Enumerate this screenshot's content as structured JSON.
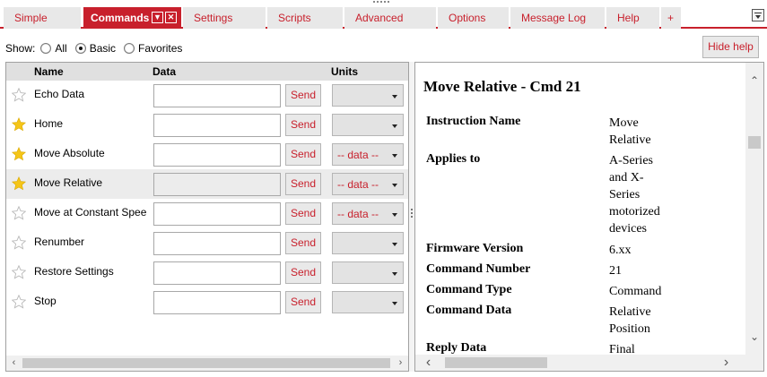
{
  "tabs": [
    {
      "label": "Simple",
      "active": false
    },
    {
      "label": "Commands",
      "active": true
    },
    {
      "label": "Settings",
      "active": false
    },
    {
      "label": "Scripts",
      "active": false
    },
    {
      "label": "Advanced",
      "active": false
    },
    {
      "label": "Options",
      "active": false
    },
    {
      "label": "Message Log",
      "active": false
    },
    {
      "label": "Help",
      "active": false
    },
    {
      "label": "+",
      "active": false
    }
  ],
  "show": {
    "label": "Show:",
    "options": [
      {
        "label": "All",
        "selected": false
      },
      {
        "label": "Basic",
        "selected": true
      },
      {
        "label": "Favorites",
        "selected": false
      }
    ]
  },
  "hide_help_label": "Hide help",
  "table": {
    "columns": {
      "name": "Name",
      "data": "Data",
      "units": "Units"
    },
    "rows": [
      {
        "name": "Echo Data",
        "favorite": false,
        "send": "Send",
        "units": "",
        "selected": false
      },
      {
        "name": "Home",
        "favorite": true,
        "send": "Send",
        "units": "",
        "selected": false
      },
      {
        "name": "Move Absolute",
        "favorite": true,
        "send": "Send",
        "units": "-- data --",
        "selected": false
      },
      {
        "name": "Move Relative",
        "favorite": true,
        "send": "Send",
        "units": "-- data --",
        "selected": true
      },
      {
        "name": "Move at Constant Spee",
        "favorite": false,
        "send": "Send",
        "units": "-- data --",
        "selected": false
      },
      {
        "name": "Renumber",
        "favorite": false,
        "send": "Send",
        "units": "",
        "selected": false
      },
      {
        "name": "Restore Settings",
        "favorite": false,
        "send": "Send",
        "units": "",
        "selected": false
      },
      {
        "name": "Stop",
        "favorite": false,
        "send": "Send",
        "units": "",
        "selected": false
      }
    ]
  },
  "help": {
    "title": "Move Relative - Cmd 21",
    "fields": [
      {
        "key": "Instruction Name",
        "value": "Move Relative"
      },
      {
        "key": "Applies to",
        "value": "A-Series and X-Series motorized devices"
      },
      {
        "key": "Firmware Version",
        "value": "6.xx"
      },
      {
        "key": "Command Number",
        "value": "21"
      },
      {
        "key": "Command Type",
        "value": "Command"
      },
      {
        "key": "Command Data",
        "value": "Relative Position"
      },
      {
        "key": "Reply Data",
        "value": "Final"
      }
    ]
  },
  "colors": {
    "accent": "#c8202c",
    "star": "#f5c518"
  }
}
